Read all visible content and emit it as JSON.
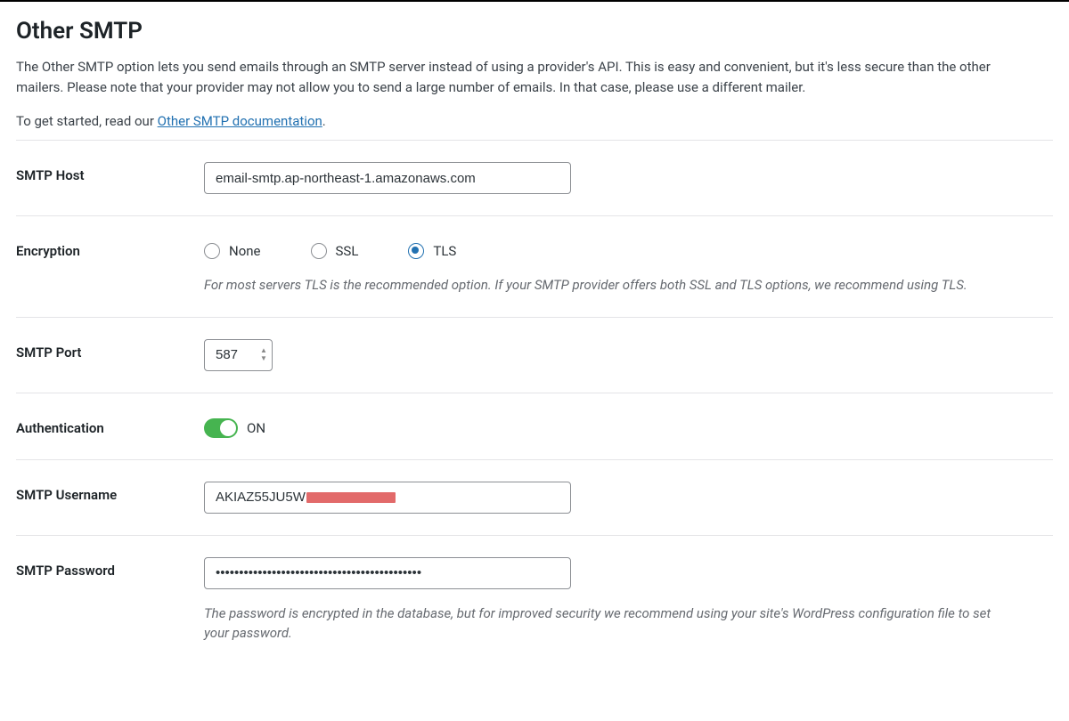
{
  "section": {
    "title": "Other SMTP",
    "description": "The Other SMTP option lets you send emails through an SMTP server instead of using a provider's API. This is easy and convenient, but it's less secure than the other mailers. Please note that your provider may not allow you to send a large number of emails. In that case, please use a different mailer.",
    "doc_prefix": "To get started, read our ",
    "doc_link_text": "Other SMTP documentation",
    "doc_suffix": "."
  },
  "fields": {
    "smtp_host": {
      "label": "SMTP Host",
      "value": "email-smtp.ap-northeast-1.amazonaws.com"
    },
    "encryption": {
      "label": "Encryption",
      "options": {
        "none": "None",
        "ssl": "SSL",
        "tls": "TLS"
      },
      "selected": "tls",
      "help": "For most servers TLS is the recommended option. If your SMTP provider offers both SSL and TLS options, we recommend using TLS."
    },
    "smtp_port": {
      "label": "SMTP Port",
      "value": "587"
    },
    "authentication": {
      "label": "Authentication",
      "state_label": "ON",
      "on": true
    },
    "smtp_username": {
      "label": "SMTP Username",
      "value": "AKIAZ55JU5W"
    },
    "smtp_password": {
      "label": "SMTP Password",
      "value": "••••••••••••••••••••••••••••••••••••••••••••",
      "help": "The password is encrypted in the database, but for improved security we recommend using your site's WordPress configuration file to set your password."
    }
  }
}
